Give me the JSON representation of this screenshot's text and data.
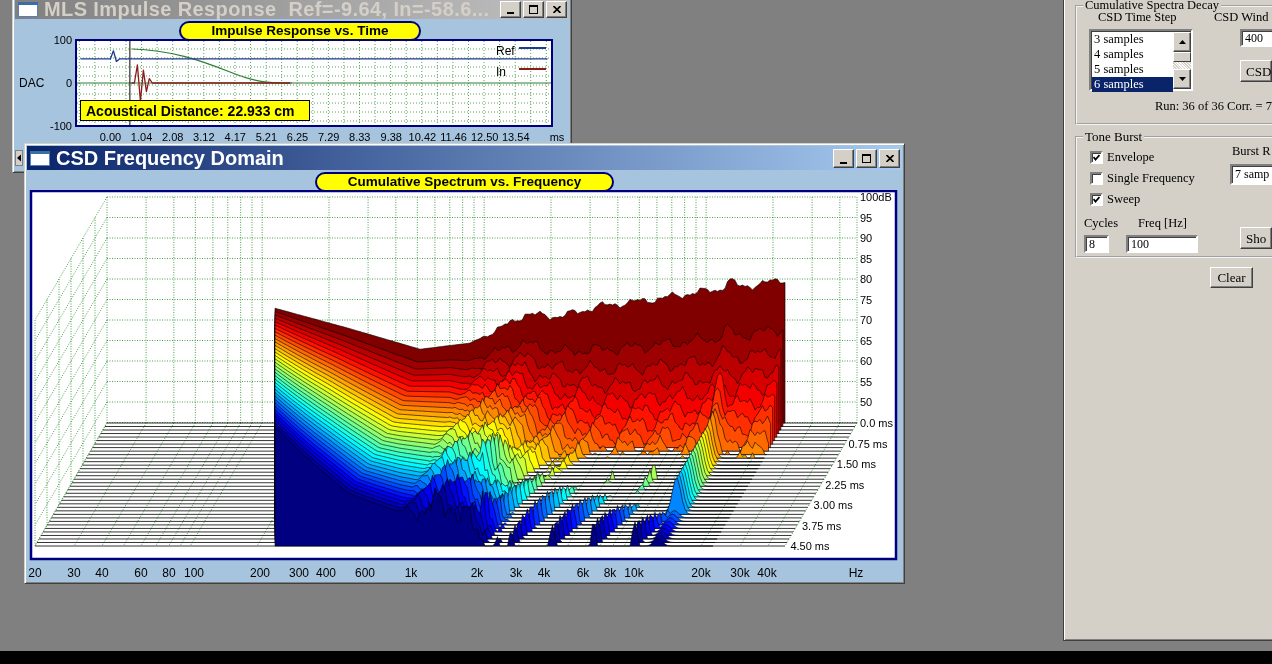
{
  "impulse_window": {
    "title": "MLS Impulse Response  Ref=-9.64, In=-58.6...",
    "active": false,
    "chart_data": {
      "type": "line",
      "title": "Impulse Response vs. Time",
      "xlabel": "ms",
      "ylabel": "DAC",
      "x": [
        -1.0,
        0.0,
        0.1,
        0.2,
        0.3,
        0.7,
        0.8,
        0.9,
        1.0,
        1.1,
        1.2,
        1.3,
        1.4,
        6.0,
        14.6
      ],
      "series": [
        {
          "name": "Ref",
          "color": "#1f3a93",
          "values": [
            56,
            56,
            75,
            50,
            56,
            56,
            56,
            56,
            56,
            56,
            56,
            56,
            56,
            56,
            56
          ]
        },
        {
          "name": "In",
          "color": "#8b1a1a",
          "values": [
            null,
            null,
            null,
            null,
            null,
            0,
            0,
            42,
            -42,
            30,
            -20,
            10,
            0,
            0,
            null
          ]
        }
      ],
      "xlim": [
        -1.15,
        14.75
      ],
      "ylim": [
        -100,
        100
      ],
      "xticks": [
        {
          "value": 0,
          "label": "0.00"
        },
        1.04,
        2.08,
        3.12,
        4.17,
        5.21,
        6.25,
        7.29,
        8.33,
        9.38,
        10.42,
        11.46,
        {
          "value": 12.5,
          "label": "12.50"
        },
        13.54
      ],
      "yticks": [
        100,
        0,
        -100
      ],
      "grid": true,
      "legend": "upper right",
      "ref_lines": [
        {
          "axis": "y",
          "value": 0,
          "color": "#2e7d32"
        },
        {
          "axis": "x",
          "value": 0.65,
          "color": "#000000"
        }
      ]
    },
    "distance_readout": "Acoustical Distance: 22.933 cm"
  },
  "csd_window": {
    "title": "CSD Frequency Domain",
    "active": true,
    "chart_title": "Cumulative Spectrum vs. Frequency",
    "level_ticks": [
      "100dB",
      "95",
      "90",
      "85",
      "80",
      "75",
      "70",
      "65",
      "60",
      "55",
      "50"
    ],
    "time_ticks": [
      "0.0 ms",
      "0.75 ms",
      "1.50 ms",
      "2.25 ms",
      "3.00 ms",
      "3.75 ms",
      "4.50 ms"
    ],
    "frequency_ticks": [
      "20",
      "30",
      "40",
      "60",
      "80",
      "100",
      "200",
      "300",
      "400",
      "600",
      "1k",
      "2k",
      "3k",
      "4k",
      "6k",
      "8k",
      "10k",
      "20k",
      "30k",
      "40k"
    ],
    "frequency_unit": "Hz"
  },
  "control_panel": {
    "decay_group": {
      "legend": "Cumulative Spectra Decay",
      "time_step_label": "CSD Time Step",
      "window_label": "CSD Wind",
      "time_steps": [
        {
          "label": "3 samples",
          "selected": false
        },
        {
          "label": "4 samples",
          "selected": false
        },
        {
          "label": "5 samples",
          "selected": false
        },
        {
          "label": "6 samples",
          "selected": true
        }
      ],
      "window_value": "400",
      "csd_button": "CSD",
      "run_status": "Run: 36 of 36 Corr. = 7"
    },
    "tone_burst_group": {
      "legend": "Tone Burst",
      "options": [
        {
          "label": "Envelope",
          "checked": true
        },
        {
          "label": "Single Frequency",
          "checked": false
        },
        {
          "label": "Sweep",
          "checked": true
        }
      ],
      "burst_label": "Burst R",
      "burst_value": "7 samp",
      "cycles_label": "Cycles",
      "cycles_value": "8",
      "freq_label": "Freq [Hz]",
      "freq_value": "100",
      "show_button": "Sho"
    },
    "clear_button": "Clear"
  }
}
